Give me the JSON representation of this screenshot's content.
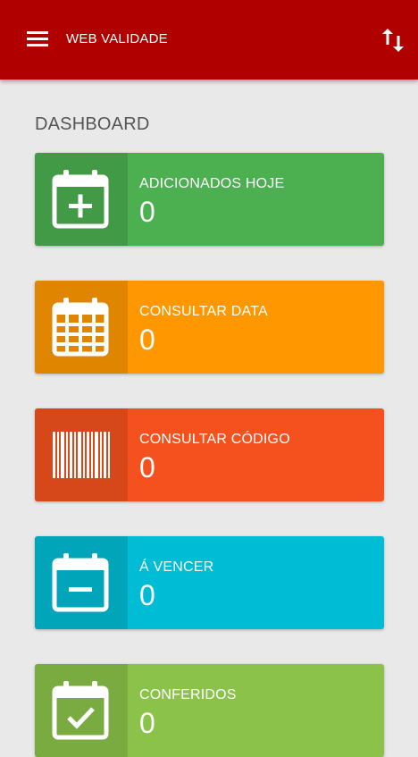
{
  "app": {
    "title": "WEB VALIDADE",
    "menu_icon": "menu-icon",
    "sort_icon": "sort-arrows-icon"
  },
  "dashboard": {
    "title": "DASHBOARD",
    "cards": [
      {
        "label": "ADICIONADOS HOJE",
        "count": "0",
        "icon": "calendar-plus-icon",
        "color": "#4caf50"
      },
      {
        "label": "CONSULTAR DATA",
        "count": "0",
        "icon": "calendar-grid-icon",
        "color": "#ff9800"
      },
      {
        "label": "CONSULTAR CÓDIGO",
        "count": "0",
        "icon": "barcode-icon",
        "color": "#f4511e"
      },
      {
        "label": "Á VENCER",
        "count": "0",
        "icon": "calendar-minus-icon",
        "color": "#00bcd4"
      },
      {
        "label": "CONFERIDOS",
        "count": "0",
        "icon": "calendar-check-icon",
        "color": "#8bc34a"
      }
    ]
  },
  "colors": {
    "appbar": "#b00000",
    "background": "#e9e9e9"
  }
}
